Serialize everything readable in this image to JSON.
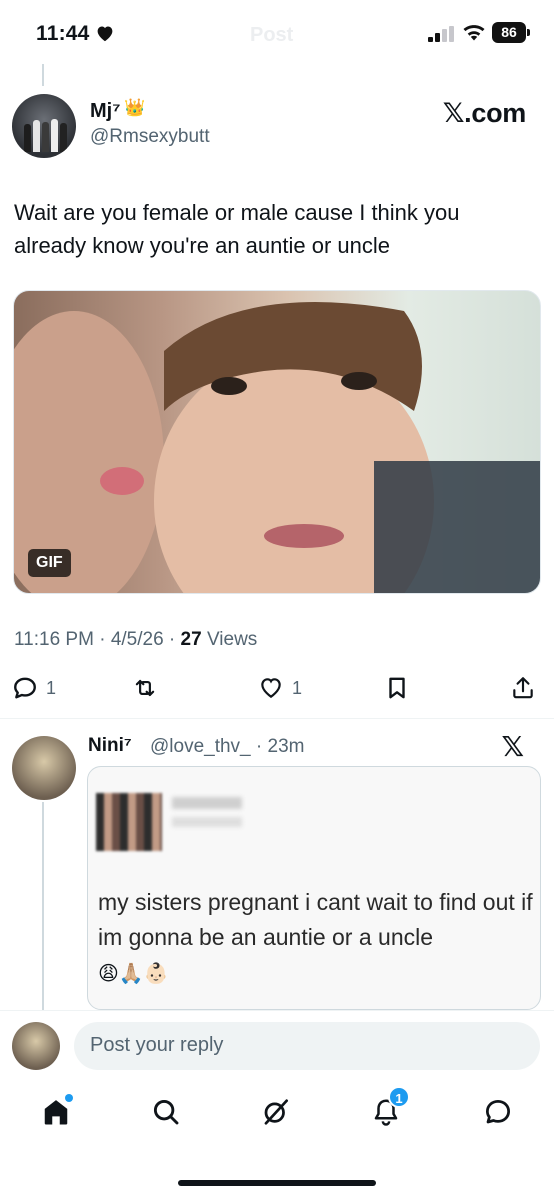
{
  "status_bar": {
    "time": "11:44",
    "ghost_title": "Post",
    "battery": "86"
  },
  "tweet": {
    "author_name": "Mj⁷",
    "author_handle": "@Rmsexybutt",
    "source_label": "𝕏.com",
    "text": "Wait are you female or male cause I think you already know you're an auntie or uncle",
    "media_badge": "GIF",
    "time": "11:16 PM",
    "date": "4/5/26",
    "views_count": "27",
    "views_label": "Views",
    "reply_count": "1",
    "like_count": "1"
  },
  "reply": {
    "author_name": "Nini⁷",
    "author_handle": "@love_thv_ · 23m",
    "source_label": "𝕏",
    "quote_text": "my sisters pregnant i cant wait to find out if im gonna be an auntie or a uncle",
    "quote_emoji": "😩🙏🏼👶🏻"
  },
  "composer": {
    "placeholder": "Post your reply"
  },
  "tabbar": {
    "notification_count": "1"
  },
  "colors": {
    "accent": "#1d9bf0",
    "secondary_text": "#536471"
  }
}
